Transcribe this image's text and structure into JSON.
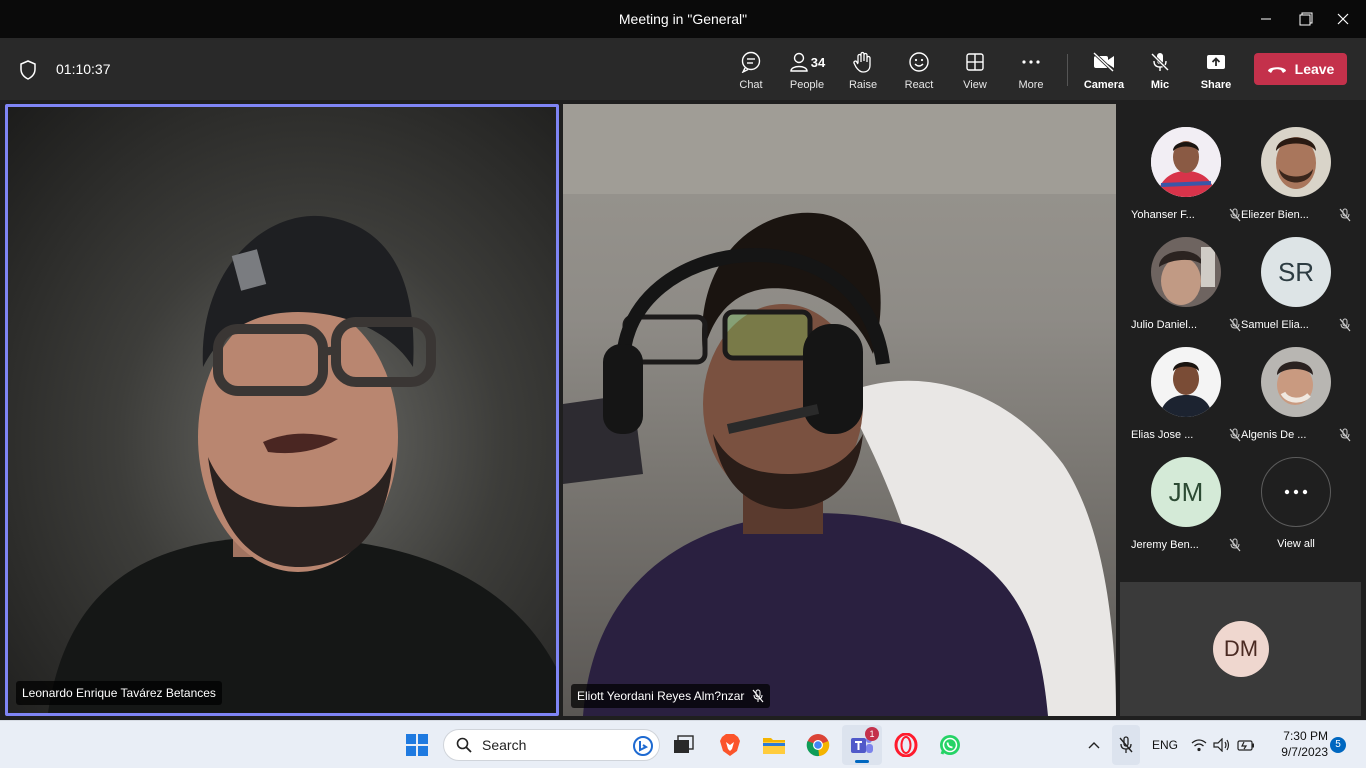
{
  "window": {
    "title": "Meeting in \"General\""
  },
  "toolbar": {
    "timer": "01:10:37",
    "chat": "Chat",
    "people": "People",
    "people_count": "34",
    "raise": "Raise",
    "react": "React",
    "view": "View",
    "more": "More",
    "camera": "Camera",
    "mic": "Mic",
    "share": "Share",
    "leave": "Leave"
  },
  "stage": {
    "tile1_name": "Leonardo Enrique Tavárez Betances",
    "tile2_name": "Eliott Yeordani Reyes Alm?nzar"
  },
  "gallery": {
    "participants": [
      {
        "name": "Yohanser F...",
        "initials": "",
        "muted": true
      },
      {
        "name": "Eliezer Bien...",
        "initials": "",
        "muted": true
      },
      {
        "name": "Julio Daniel...",
        "initials": "",
        "muted": true
      },
      {
        "name": "Samuel Elia...",
        "initials": "SR",
        "muted": true
      },
      {
        "name": "Elias Jose ...",
        "initials": "",
        "muted": true
      },
      {
        "name": "Algenis De ...",
        "initials": "",
        "muted": true
      },
      {
        "name": "Jeremy Ben...",
        "initials": "JM",
        "muted": true
      }
    ],
    "view_all": "View all",
    "self_initials": "DM"
  },
  "taskbar": {
    "search_placeholder": "Search",
    "teams_badge": "1",
    "language": "ENG",
    "time": "7:30 PM",
    "date": "9/7/2023",
    "notifications": "5"
  },
  "colors": {
    "accent": "#7f85f5",
    "leave": "#c4314b",
    "toolbar": "#292929",
    "titlebar": "#0a0a0a"
  }
}
